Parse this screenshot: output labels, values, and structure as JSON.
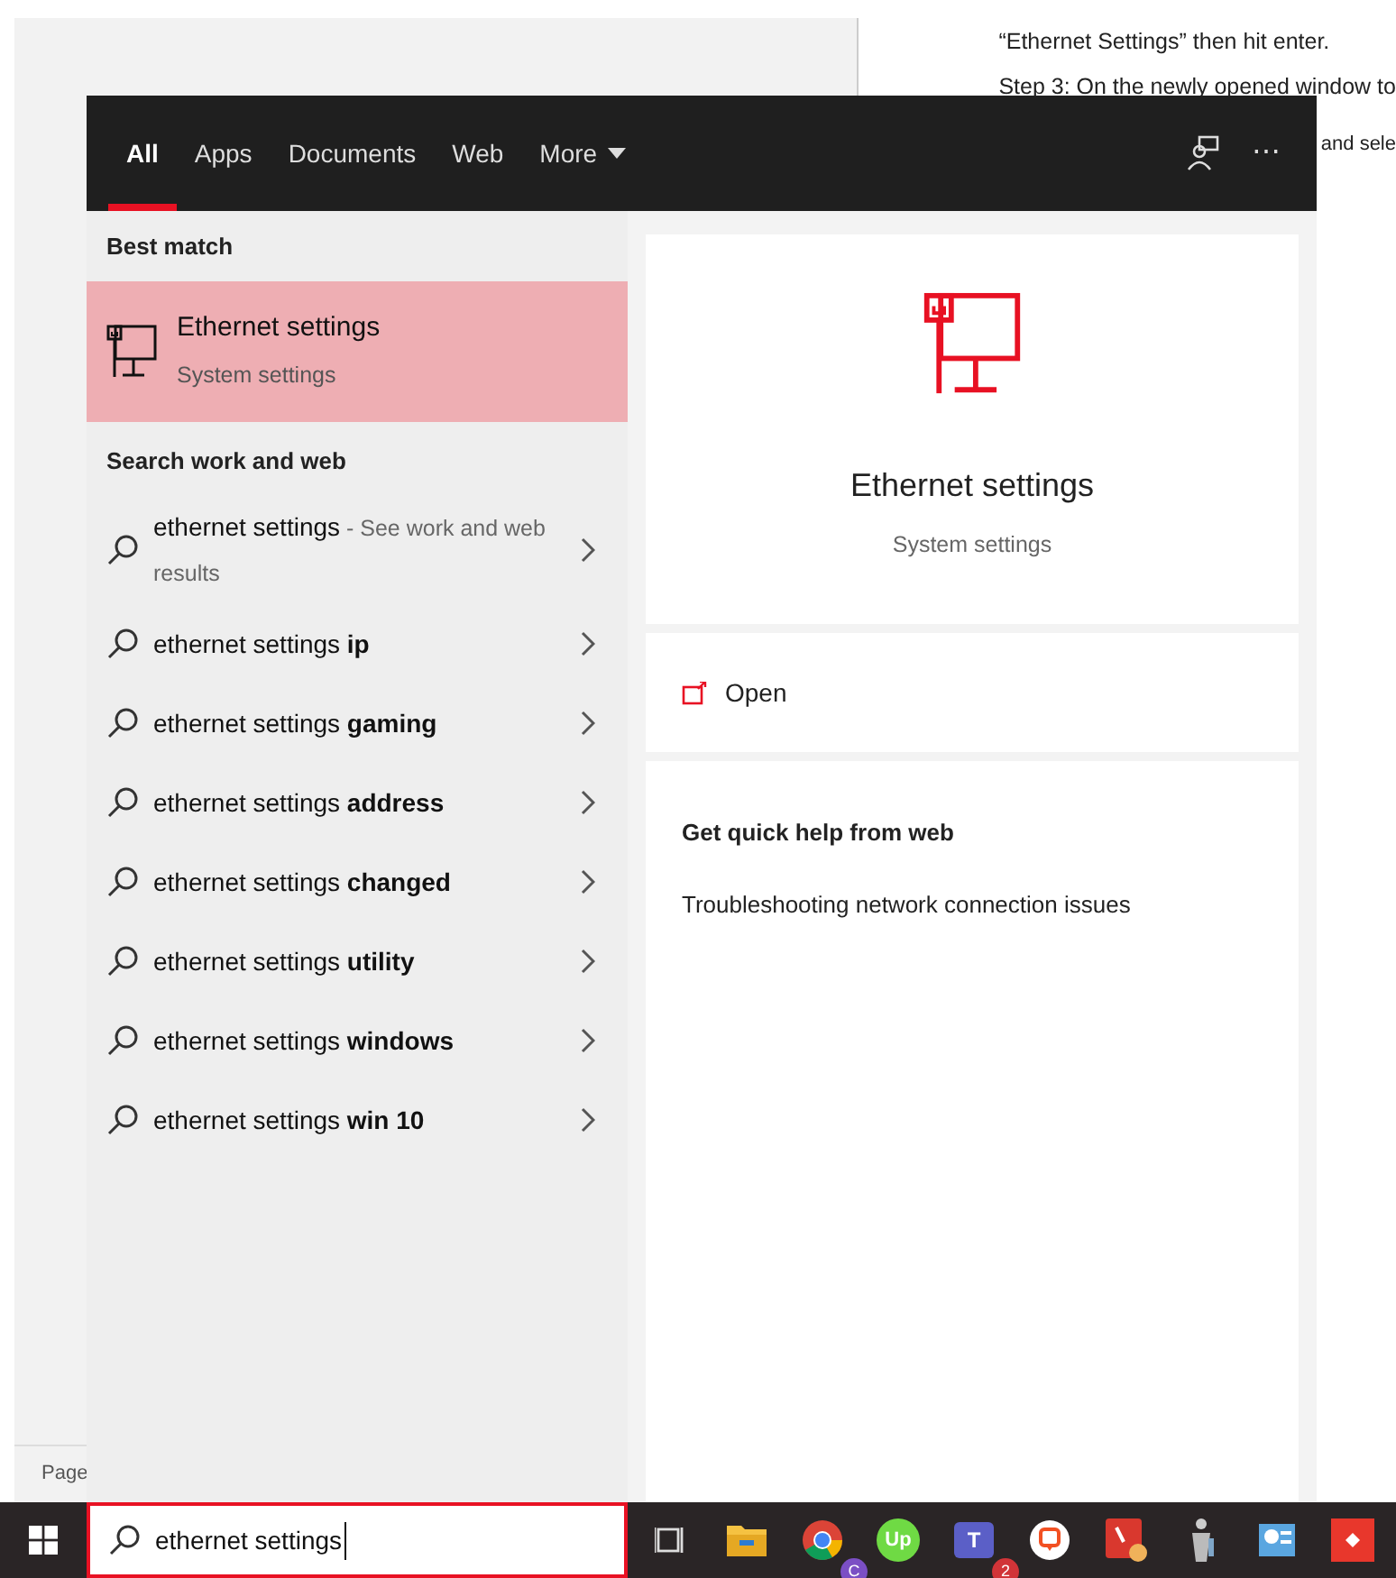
{
  "document": {
    "lines": [
      "“Ethernet Settings” then hit enter.",
      "Step 3: On the newly opened window to",
      "and sele"
    ],
    "status_text": "Page"
  },
  "search_panel": {
    "tabs": [
      {
        "label": "All",
        "selected": true
      },
      {
        "label": "Apps",
        "selected": false
      },
      {
        "label": "Documents",
        "selected": false
      },
      {
        "label": "Web",
        "selected": false
      },
      {
        "label": "More",
        "selected": false,
        "dropdown": true
      }
    ],
    "more_glyph": "⋯",
    "best_match_heading": "Best match",
    "best_match": {
      "title": "Ethernet settings",
      "subtitle": "System settings",
      "selected": true
    },
    "web_heading": "Search work and web",
    "suggestions": [
      {
        "query": "ethernet settings",
        "note": "- See work and web results"
      },
      {
        "query": "ethernet settings",
        "bold": "ip"
      },
      {
        "query": "ethernet settings",
        "bold": "gaming"
      },
      {
        "query": "ethernet settings",
        "bold": "address"
      },
      {
        "query": "ethernet settings",
        "bold": "changed"
      },
      {
        "query": "ethernet settings",
        "bold": "utility"
      },
      {
        "query": "ethernet settings",
        "bold": "windows"
      },
      {
        "query": "ethernet settings",
        "bold": "win 10"
      }
    ],
    "preview": {
      "title": "Ethernet settings",
      "subtitle": "System settings",
      "action": "Open",
      "help_heading": "Get quick help from web",
      "help_links": [
        "Troubleshooting network connection issues"
      ]
    }
  },
  "taskbar": {
    "search_value": "ethernet settings",
    "apps": [
      {
        "kind": "taskview"
      },
      {
        "kind": "folder"
      },
      {
        "kind": "chrome",
        "badge": "C"
      },
      {
        "kind": "upwork",
        "label": "Up"
      },
      {
        "kind": "teams",
        "label": "T",
        "badge": "2"
      },
      {
        "kind": "chat"
      },
      {
        "kind": "redapp"
      },
      {
        "kind": "figure"
      },
      {
        "kind": "blueapp"
      },
      {
        "kind": "diamond"
      }
    ]
  }
}
